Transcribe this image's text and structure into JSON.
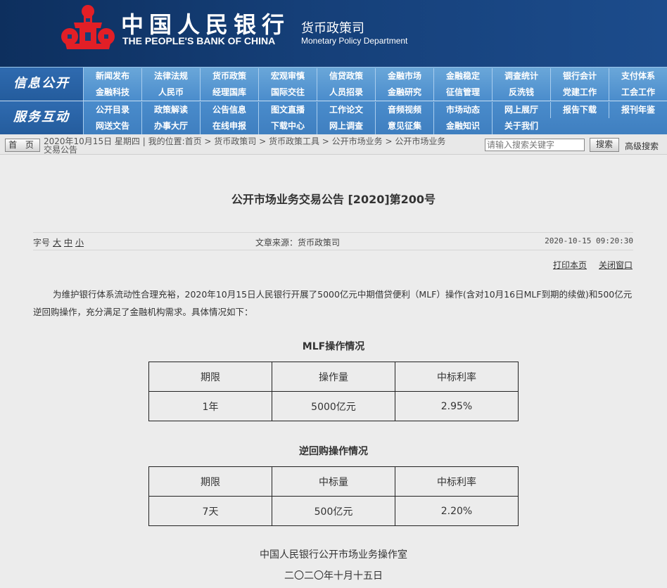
{
  "header": {
    "bank_name_cn": "中国人民银行",
    "bank_name_en": "THE PEOPLE'S BANK OF CHINA",
    "dept_name_cn": "货币政策司",
    "dept_name_en": "Monetary Policy Department",
    "colors": {
      "header_bg": "#153f78",
      "emblem_red": "#e21f26",
      "nav_bg": "#4a8ccc"
    }
  },
  "nav": {
    "band1_label": "信息公开",
    "band1_row1": [
      "新闻发布",
      "法律法规",
      "货币政策",
      "宏观审慎",
      "信贷政策",
      "金融市场",
      "金融稳定",
      "调查统计",
      "银行会计",
      "支付体系"
    ],
    "band1_row2": [
      "金融科技",
      "人民币",
      "经理国库",
      "国际交往",
      "人员招录",
      "金融研究",
      "征信管理",
      "反洗钱",
      "党建工作",
      "工会工作"
    ],
    "band2_label": "服务互动",
    "band2_row1": [
      "公开目录",
      "政策解读",
      "公告信息",
      "图文直播",
      "工作论文",
      "音频视频",
      "市场动态",
      "网上展厅",
      "报告下载",
      "报刊年鉴"
    ],
    "band2_row2": [
      "网送文告",
      "办事大厅",
      "在线申报",
      "下载中心",
      "网上调查",
      "意见征集",
      "金融知识",
      "关于我们"
    ]
  },
  "crumbbar": {
    "home_label": "首 页",
    "line1": "2020年10月15日 星期四 | 我的位置:首页  >  货币政策司  >  货币政策工具  >  公开市场业务  >  公开市场业务",
    "line2": "交易公告",
    "search_placeholder": "请输入搜索关键字",
    "search_button": "搜索",
    "advanced_search": "高级搜索"
  },
  "article": {
    "title": "公开市场业务交易公告 [2020]第200号",
    "font_size_label": "字号",
    "font_size_options": [
      "大",
      "中",
      "小"
    ],
    "source": "文章来源：货币政策司",
    "publish_time": "2020-10-15 09:20:30",
    "print_label": "打印本页",
    "close_label": "关闭窗口",
    "paragraph": "为维护银行体系流动性合理充裕，2020年10月15日人民银行开展了5000亿元中期借贷便利（MLF）操作(含对10月16日MLF到期的续做)和500亿元逆回购操作，充分满足了金融机构需求。具体情况如下：",
    "mlf_caption": "MLF操作情况",
    "mlf_table": {
      "headers": [
        "期限",
        "操作量",
        "中标利率"
      ],
      "rows": [
        [
          "1年",
          "5000亿元",
          "2.95%"
        ]
      ]
    },
    "repo_caption": "逆回购操作情况",
    "repo_table": {
      "headers": [
        "期限",
        "中标量",
        "中标利率"
      ],
      "rows": [
        [
          "7天",
          "500亿元",
          "2.20%"
        ]
      ]
    },
    "signature": "中国人民银行公开市场业务操作室",
    "date": "二〇二〇年十月十五日"
  }
}
